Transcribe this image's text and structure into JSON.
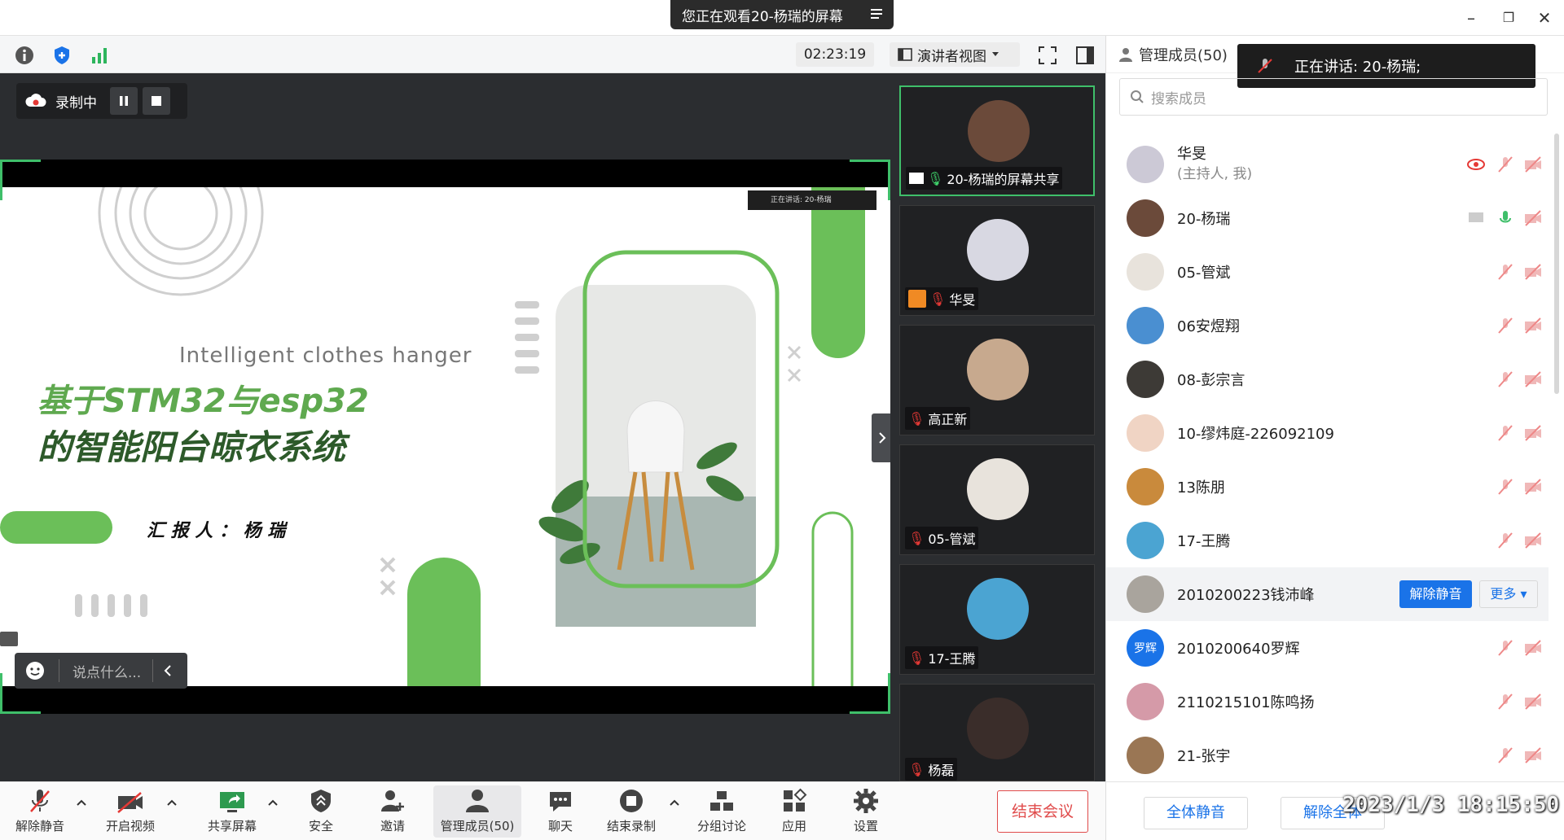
{
  "titlebar": {
    "banner": "您正在观看20-杨瑞的屏幕"
  },
  "toolbar": {
    "timer": "02:23:19",
    "view_mode": "演讲者视图"
  },
  "recording": {
    "label": "录制中"
  },
  "chat": {
    "placeholder": "说点什么..."
  },
  "slide": {
    "subtitle_en": "Intelligent clothes hanger",
    "title_line1": "基于STM32与esp32",
    "title_line2": "的智能阳台晾衣系统",
    "reporter": "汇 报 人 ： 杨 瑞",
    "mini_banner": "正在讲话: 20-杨瑞"
  },
  "gallery": {
    "tiles": [
      {
        "name": "20-杨瑞的屏幕共享",
        "color": "#6b4a3a"
      },
      {
        "name": "华旻",
        "color": "#d8d8e2"
      },
      {
        "name": "高正新",
        "color": "#c7a98e"
      },
      {
        "name": "05-管斌",
        "color": "#e8e3dc"
      },
      {
        "name": "17-王腾",
        "color": "#4ba4d2"
      },
      {
        "name": "杨磊",
        "color": "#3a2d2a"
      }
    ]
  },
  "panel": {
    "header": "管理成员(50)",
    "speaking": "正在讲话: 20-杨瑞;",
    "search_placeholder": "搜索成员",
    "members": [
      {
        "name": "华旻",
        "sub": "(主持人, 我)",
        "color": "#ccc9d6"
      },
      {
        "name": "20-杨瑞",
        "sub": "",
        "color": "#6b4a3a"
      },
      {
        "name": "05-管斌",
        "sub": "",
        "color": "#e8e3dc"
      },
      {
        "name": "06安煜翔",
        "sub": "",
        "color": "#4a8fd1"
      },
      {
        "name": "08-彭宗言",
        "sub": "",
        "color": "#3d3a36"
      },
      {
        "name": "10-缪炜庭-226092109",
        "sub": "",
        "color": "#f0d4c4"
      },
      {
        "name": "13陈朋",
        "sub": "",
        "color": "#c98a3c"
      },
      {
        "name": "17-王腾",
        "sub": "",
        "color": "#4ba4d2"
      },
      {
        "name": "2010200223钱沛峰",
        "sub": "",
        "color": "#a9a49d"
      },
      {
        "name": "2010200640罗辉",
        "sub": "",
        "color": "#1a73e8",
        "initials": "罗辉"
      },
      {
        "name": "2110215101陈鸣扬",
        "sub": "",
        "color": "#d59aa8"
      },
      {
        "name": "21-张宇",
        "sub": "",
        "color": "#9a7654"
      }
    ],
    "unmute_label": "解除静音",
    "more_label": "更多",
    "mute_all": "全体静音",
    "unmute_all": "解除全体"
  },
  "bottom": {
    "items": [
      {
        "label": "解除静音"
      },
      {
        "label": "开启视频"
      },
      {
        "label": "共享屏幕"
      },
      {
        "label": "安全"
      },
      {
        "label": "邀请"
      },
      {
        "label": "管理成员(50)"
      },
      {
        "label": "聊天"
      },
      {
        "label": "结束录制"
      },
      {
        "label": "分组讨论"
      },
      {
        "label": "应用"
      },
      {
        "label": "设置"
      }
    ],
    "end_meeting": "结束会议"
  },
  "timestamp": "2023/1/3  18:15:50",
  "colors": {
    "accent": "#1a73e8",
    "green": "#6bbf59",
    "danger": "#e04b4b"
  }
}
